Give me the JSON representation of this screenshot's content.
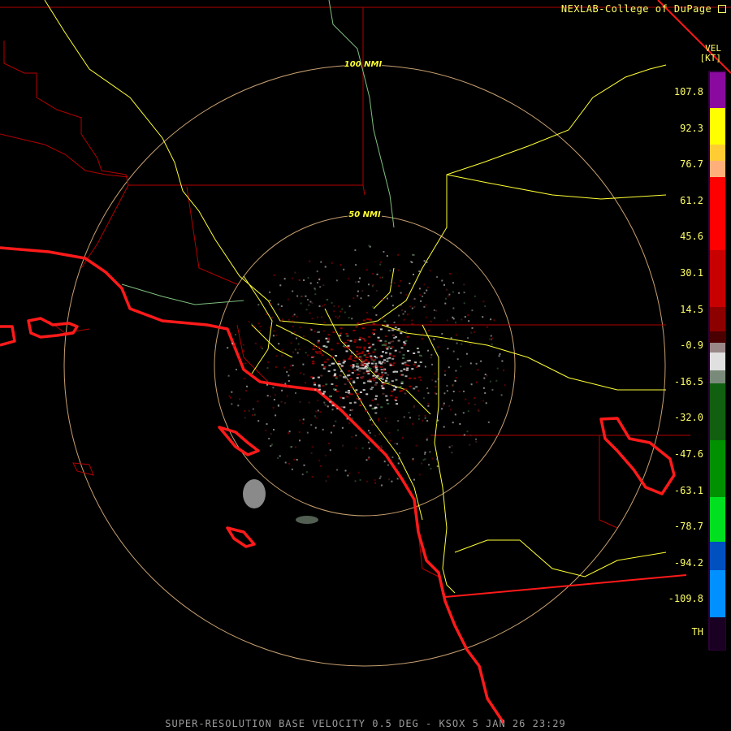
{
  "credit": "NEXLAB-College of DuPage",
  "caption": "SUPER-RESOLUTION BASE VELOCITY 0.5 DEG - KSOX 5 JAN 26 23:29",
  "rings": [
    {
      "label": "100 NMI"
    },
    {
      "label": "50 NMI"
    }
  ],
  "legend": {
    "product": "VEL",
    "units": "[KT]",
    "ticks": [
      "107.8",
      "92.3",
      "76.7",
      "61.2",
      "45.6",
      "30.1",
      "14.5",
      "-0.9",
      "-16.5",
      "-32.0",
      "-47.6",
      "-63.1",
      "-78.7",
      "-94.2",
      "-109.8",
      "TH"
    ]
  },
  "colors": {
    "range_ring": "#c8a070",
    "coastline": "#ff1a1a",
    "highway": "#ffff33",
    "county": "#b30000",
    "label": "#ffff66"
  }
}
